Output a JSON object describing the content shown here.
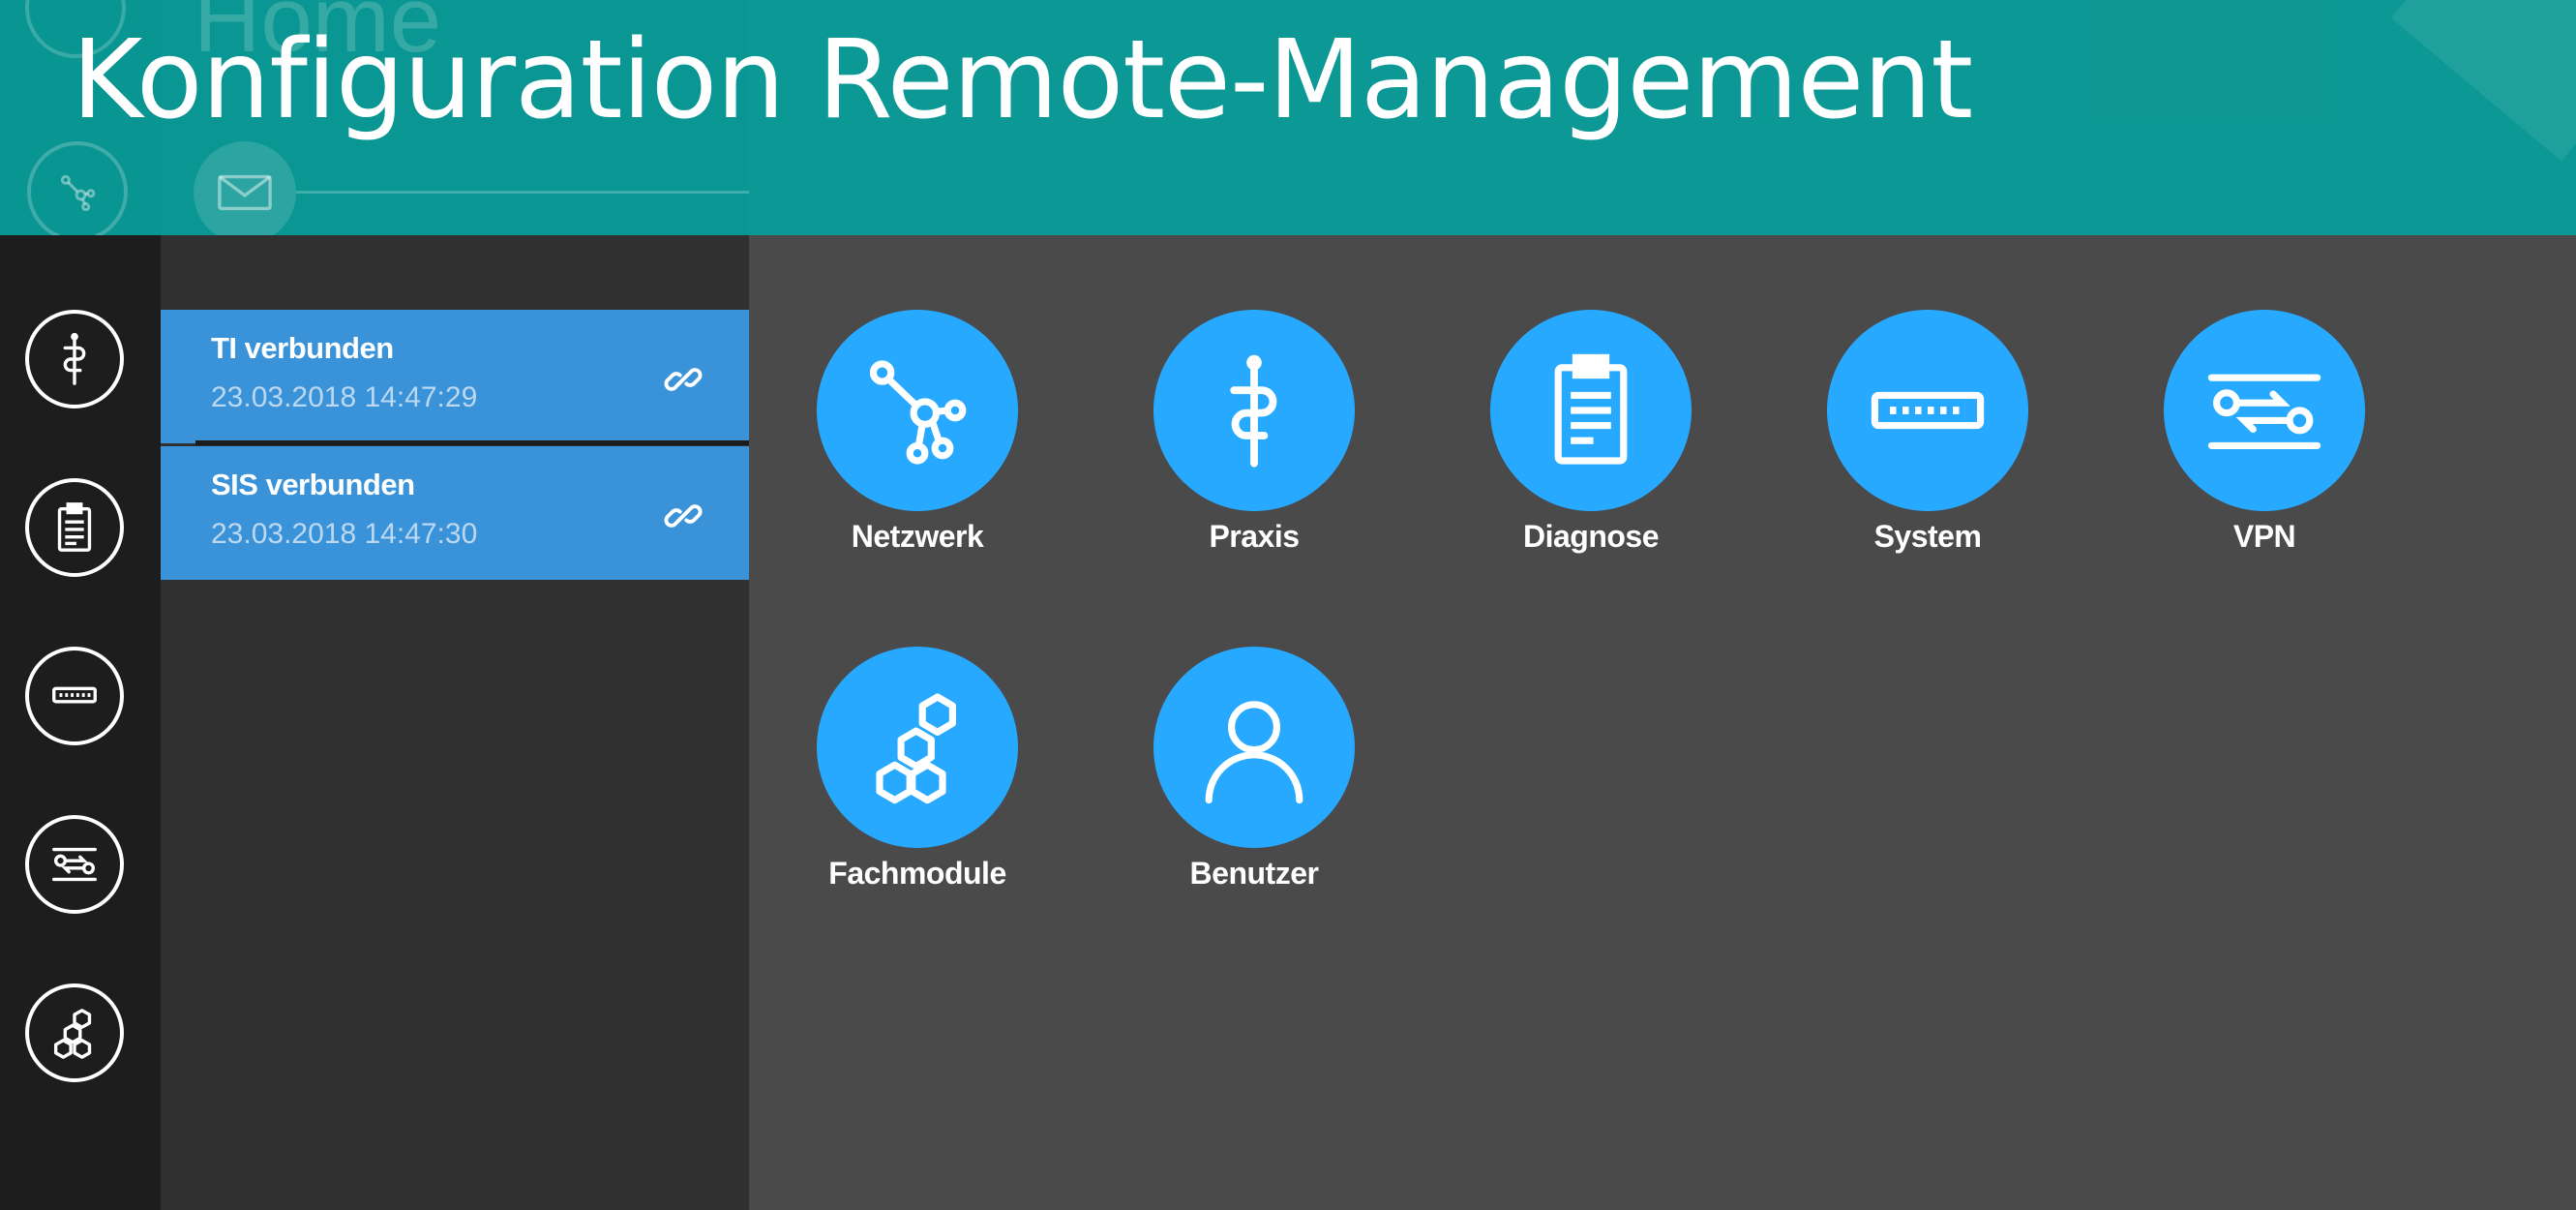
{
  "header": {
    "title": "Konfiguration Remote-Management",
    "background_text": "Home"
  },
  "status": {
    "items": [
      {
        "title": "TI verbunden",
        "timestamp": "23.03.2018 14:47:29",
        "icon": "link-icon"
      },
      {
        "title": "SIS verbunden",
        "timestamp": "23.03.2018 14:47:30",
        "icon": "link-icon"
      }
    ]
  },
  "rail": {
    "items": [
      {
        "icon": "grid-icon"
      },
      {
        "icon": "network-icon"
      },
      {
        "icon": "caduceus-icon"
      },
      {
        "icon": "clipboard-icon"
      },
      {
        "icon": "router-icon"
      },
      {
        "icon": "vpn-icon"
      },
      {
        "icon": "hexagons-icon"
      }
    ],
    "mail_icon": "mail-icon"
  },
  "tiles": [
    {
      "label": "Netzwerk",
      "icon": "network-icon"
    },
    {
      "label": "Praxis",
      "icon": "caduceus-icon"
    },
    {
      "label": "Diagnose",
      "icon": "clipboard-icon"
    },
    {
      "label": "System",
      "icon": "router-icon"
    },
    {
      "label": "VPN",
      "icon": "vpn-icon"
    },
    {
      "label": "Fachmodule",
      "icon": "hexagons-icon"
    },
    {
      "label": "Benutzer",
      "icon": "user-icon"
    }
  ],
  "colors": {
    "accent": "#27a9ff",
    "status_blue": "#3a93d8",
    "banner_teal": "#089e9a",
    "rail_bg": "#1d1d1d",
    "panel_bg": "#303030",
    "main_bg": "#4a4a4a"
  }
}
